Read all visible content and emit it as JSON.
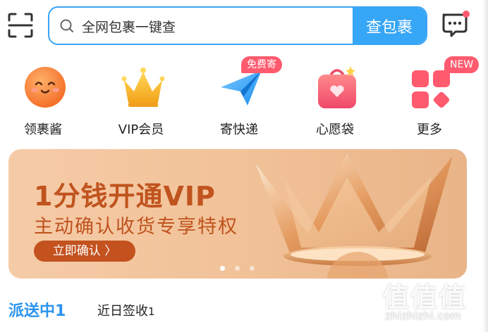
{
  "search": {
    "placeholder": "全网包裹一键查",
    "button_label": "查包裹"
  },
  "shortcuts": [
    {
      "label": "领裹酱",
      "icon": "smiley-face-icon"
    },
    {
      "label": "VIP会员",
      "icon": "crown-icon"
    },
    {
      "label": "寄快递",
      "icon": "paper-plane-icon",
      "tag": "免费寄"
    },
    {
      "label": "心愿袋",
      "icon": "heart-bag-icon"
    },
    {
      "label": "更多",
      "icon": "grid-icon",
      "tag": "NEW"
    }
  ],
  "banner": {
    "title": "1分钱开通VIP",
    "subtitle": "主动确认收货专享特权",
    "cta": "立即确认 〉",
    "active_slide": 1,
    "slide_count": 3
  },
  "tabs": [
    {
      "label": "派送中",
      "count": "1"
    },
    {
      "label": "近日签收",
      "count": "1"
    }
  ],
  "watermark": {
    "text": "值值值",
    "site": "zhizhizhi.com"
  },
  "colors": {
    "accent": "#36a6f6",
    "tag": "#ff5a6e",
    "banner_text": "#c0531e"
  }
}
